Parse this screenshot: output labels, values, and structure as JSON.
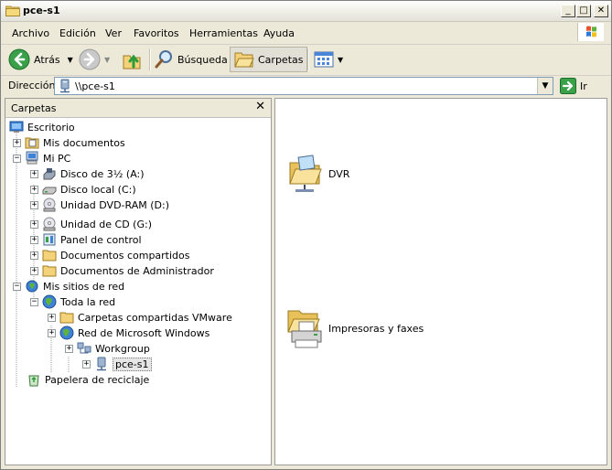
{
  "window": {
    "title": "pce-s1"
  },
  "caption_buttons": [
    "_",
    "□",
    "✕"
  ],
  "menu": [
    {
      "label": "Archivo"
    },
    {
      "label": "Edición"
    },
    {
      "label": "Ver"
    },
    {
      "label": "Favoritos"
    },
    {
      "label": "Herramientas"
    },
    {
      "label": "Ayuda"
    }
  ],
  "toolbar": {
    "back_label": "Atrás",
    "search_label": "Búsqueda",
    "folders_label": "Carpetas"
  },
  "address": {
    "label": "Dirección",
    "value": "\\\\pce-s1",
    "go_label": "Ir"
  },
  "folders_pane": {
    "title": "Carpetas",
    "close": "✕",
    "tree": [
      {
        "label": "Escritorio",
        "expander": ""
      },
      {
        "label": "Mis documentos",
        "expander": "+"
      },
      {
        "label": "Mi PC",
        "expander": "−"
      },
      {
        "label": "Disco de 3½ (A:)",
        "expander": "+"
      },
      {
        "label": "Disco local (C:)",
        "expander": "+"
      },
      {
        "label": "Unidad DVD-RAM (D:)",
        "expander": "+"
      },
      {
        "label": "Unidad de CD (G:)",
        "expander": "+"
      },
      {
        "label": "Panel de control",
        "expander": "+"
      },
      {
        "label": "Documentos compartidos",
        "expander": "+"
      },
      {
        "label": "Documentos de Administrador",
        "expander": "+"
      },
      {
        "label": "Mis sitios de red",
        "expander": "−"
      },
      {
        "label": "Toda la red",
        "expander": "−"
      },
      {
        "label": "Carpetas compartidas VMware",
        "expander": "+"
      },
      {
        "label": "Red de Microsoft Windows",
        "expander": "+"
      },
      {
        "label": "Workgroup",
        "expander": "+"
      },
      {
        "label": "pce-s1",
        "expander": "+"
      },
      {
        "label": "Papelera de reciclaje",
        "expander": ""
      }
    ]
  },
  "content": {
    "items": [
      {
        "label": "DVR",
        "icon": "shared-folder-icon"
      },
      {
        "label": "Impresoras y faxes",
        "icon": "printers-folder-icon"
      }
    ]
  },
  "colors": {
    "accent_green": "#3aa04a",
    "selection": "#e6e6e6",
    "folder_yellow": "#f3d27a"
  }
}
